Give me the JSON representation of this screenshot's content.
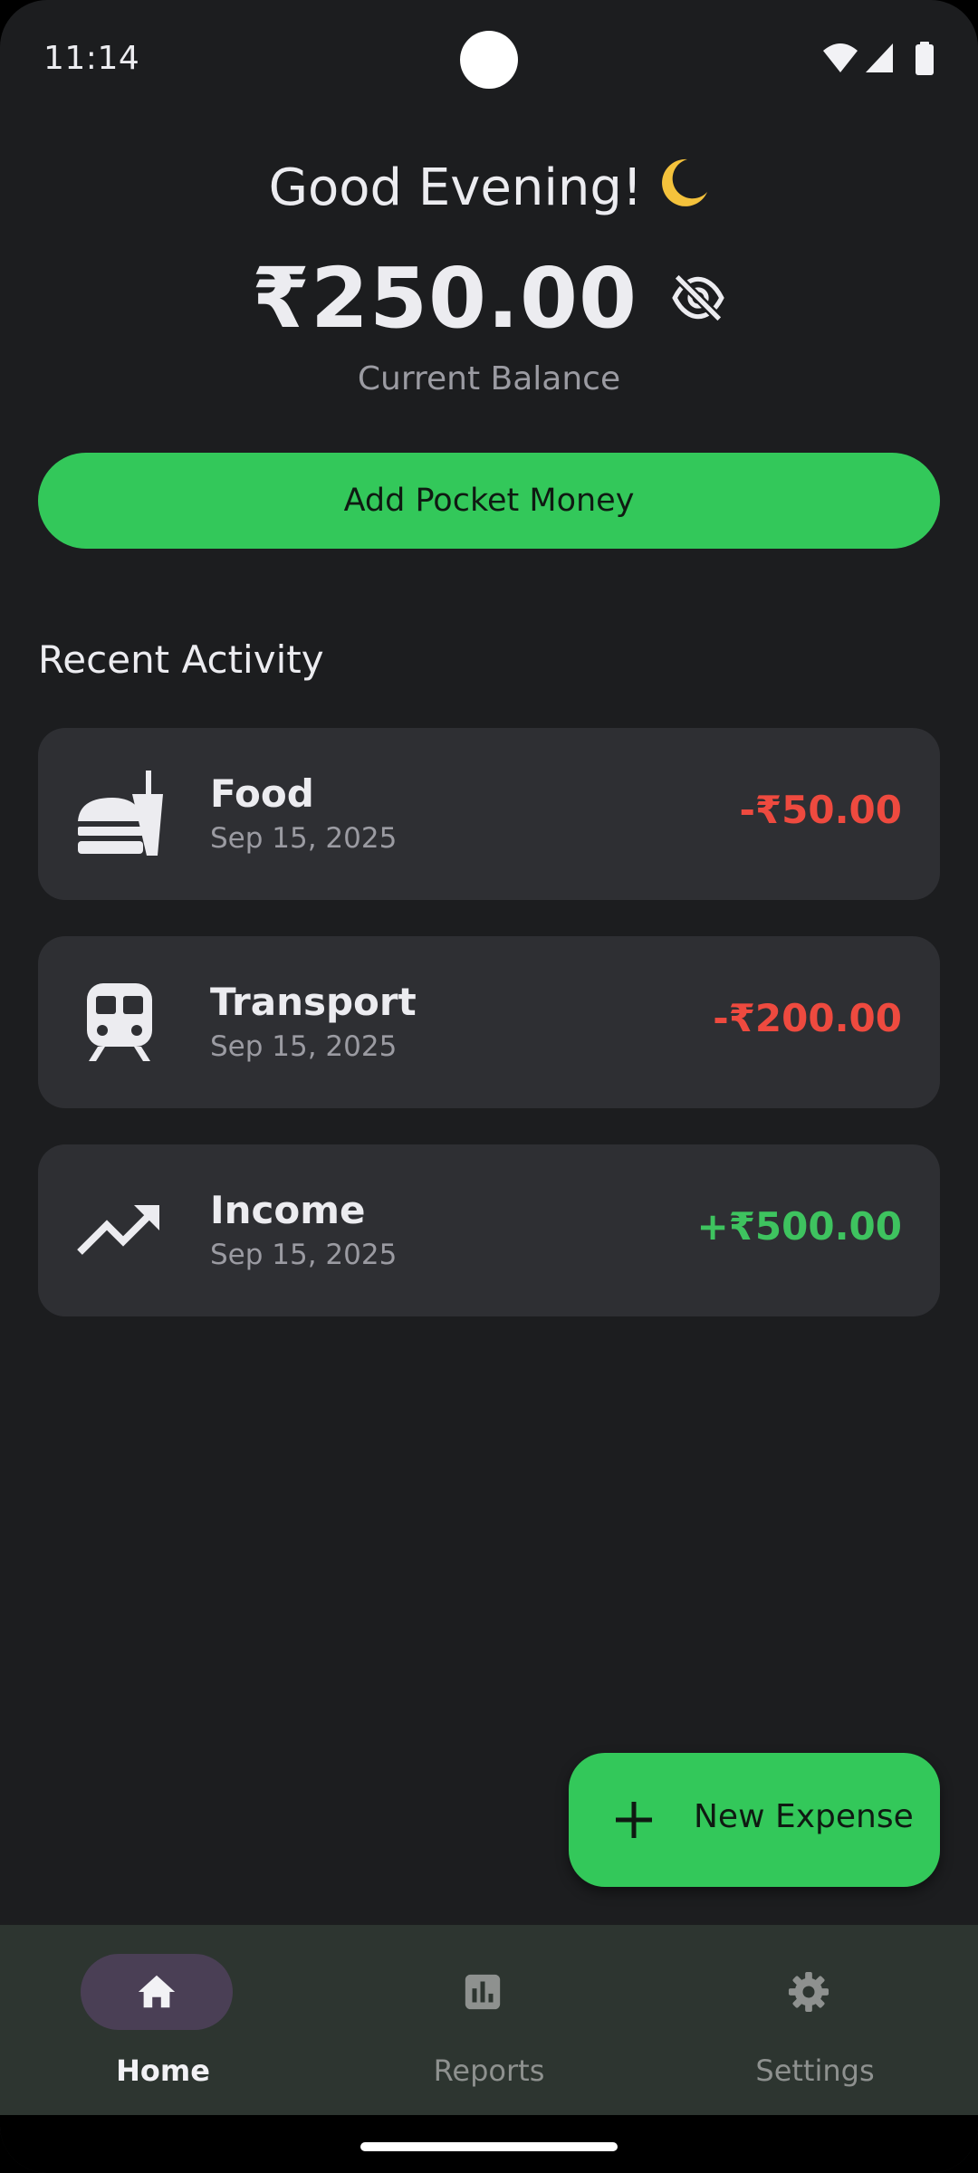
{
  "status_bar": {
    "time": "11:14",
    "icons": [
      "wifi-icon",
      "signal-icon",
      "battery-icon"
    ]
  },
  "header": {
    "greeting": "Good Evening!",
    "greeting_icon": "moon-icon",
    "balance": "₹250.00",
    "balance_visibility_icon": "eye-off-icon",
    "balance_label": "Current Balance"
  },
  "add_money_button": {
    "label": "Add Pocket Money"
  },
  "recent_activity": {
    "title": "Recent Activity",
    "items": [
      {
        "icon": "fastfood-icon",
        "category": "Food",
        "date": "Sep 15, 2025",
        "amount": "-₹50.00",
        "type": "expense"
      },
      {
        "icon": "train-icon",
        "category": "Transport",
        "date": "Sep 15, 2025",
        "amount": "-₹200.00",
        "type": "expense"
      },
      {
        "icon": "trending-up-icon",
        "category": "Income",
        "date": "Sep 15, 2025",
        "amount": "+₹500.00",
        "type": "income"
      }
    ]
  },
  "fab": {
    "icon": "plus-icon",
    "label": "New Expense"
  },
  "bottom_nav": {
    "items": [
      {
        "label": "Home",
        "icon": "home-icon",
        "active": true
      },
      {
        "label": "Reports",
        "icon": "bar-chart-icon",
        "active": false
      },
      {
        "label": "Settings",
        "icon": "gear-icon",
        "active": false
      }
    ]
  },
  "colors": {
    "background": "#1c1d1f",
    "card": "#2e2f33",
    "accent_green": "#33c85a",
    "expense_red": "#ee4a3f",
    "income_green": "#3ec35f",
    "nav_background": "#2d3530",
    "nav_active_pill": "#4a3f55"
  }
}
